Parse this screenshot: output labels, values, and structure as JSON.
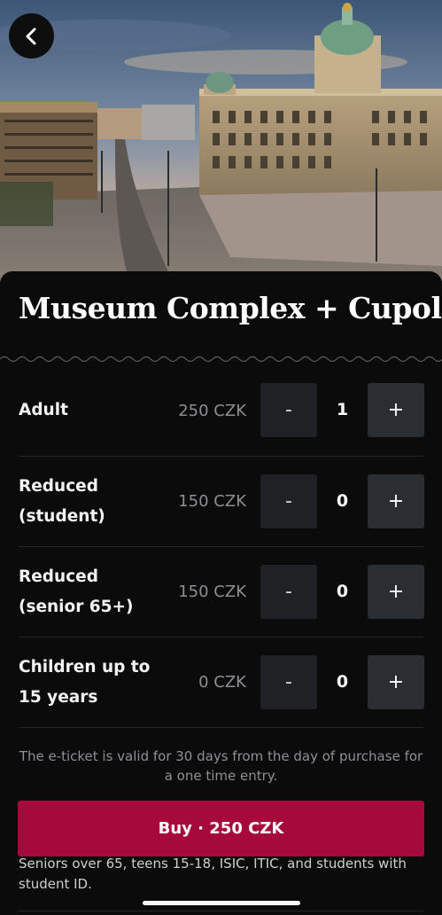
{
  "header": {
    "back_icon": "chevron-left-icon"
  },
  "ticket": {
    "title": "Museum Complex + Cupola",
    "rows": [
      {
        "label": "Adult",
        "price": "250 CZK",
        "minus": "-",
        "qty": "1",
        "plus": "+"
      },
      {
        "label": "Reduced (student)",
        "price": "150 CZK",
        "minus": "-",
        "qty": "0",
        "plus": "+"
      },
      {
        "label": "Reduced (senior 65+)",
        "price": "150 CZK",
        "minus": "-",
        "qty": "0",
        "plus": "+"
      },
      {
        "label": "Children up to 15 years",
        "price": "0 CZK",
        "minus": "-",
        "qty": "0",
        "plus": "+"
      }
    ],
    "validity_note": "The e-ticket is valid for 30 days from the day of purchase for a one time entry.",
    "buy_label": "Buy · 250 CZK",
    "reduced_info": "Seniors over 65, teens 15-18, ISIC, ITIC, and students with student ID."
  },
  "colors": {
    "background": "#0b0b0c",
    "buy_button": "#a60a3d",
    "stepper_button": "#2a2d31"
  }
}
